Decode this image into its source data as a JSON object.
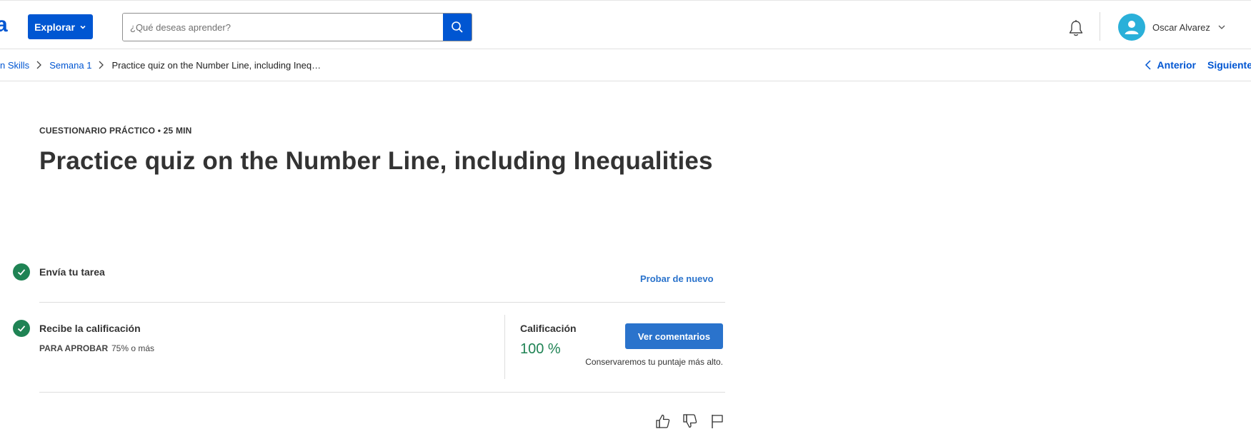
{
  "header": {
    "logo_fragment": "a",
    "explore_label": "Explorar",
    "search_placeholder": "¿Qué deseas aprender?",
    "user_name": "Oscar Alvarez"
  },
  "breadcrumb": {
    "items": [
      "n Skills",
      "Semana 1"
    ],
    "current": "Practice quiz on the Number Line, including Ineq…",
    "prev_label": "Anterior",
    "next_label": "Siguiente"
  },
  "main": {
    "eyebrow": "CUESTIONARIO PRÁCTICO • 25 MIN",
    "title": "Practice quiz on the Number Line, including Inequalities",
    "step1": {
      "title": "Envía tu tarea",
      "action": "Probar de nuevo"
    },
    "step2": {
      "title": "Recibe la calificación",
      "pass_label": "PARA APROBAR",
      "pass_value": "75% o más",
      "grade_label": "Calificación",
      "grade_value": "100 %",
      "feedback_button": "Ver comentarios",
      "keep_note": "Conservaremos tu puntaje más alto."
    }
  },
  "colors": {
    "brand": "#0056d2",
    "success": "#1f8354",
    "link": "#2a73cc"
  },
  "icons": [
    "chevron-down-icon",
    "search-icon",
    "bell-icon",
    "user-avatar-icon",
    "chevron-right-icon",
    "chevron-left-icon",
    "check-icon",
    "thumbs-up-icon",
    "thumbs-down-icon",
    "flag-icon"
  ]
}
